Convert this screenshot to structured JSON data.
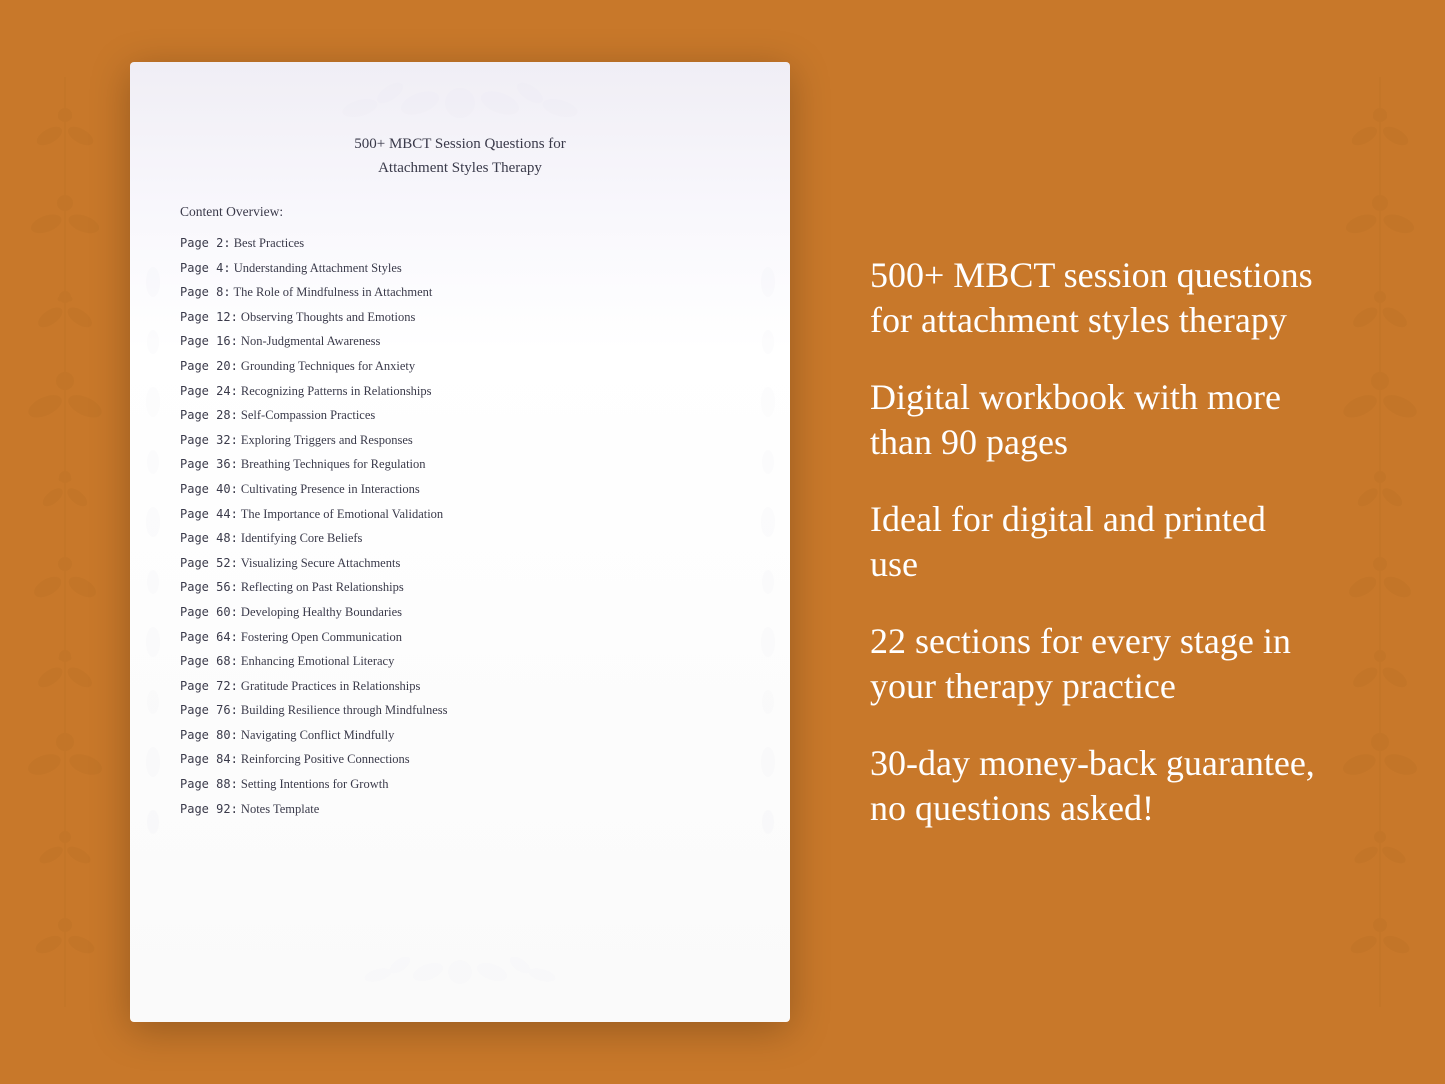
{
  "background_color": "#C8782A",
  "document": {
    "title_line1": "500+ MBCT Session Questions for",
    "title_line2": "Attachment Styles Therapy",
    "content_overview_label": "Content Overview:",
    "toc_items": [
      {
        "page": "Page  2:",
        "title": "Best Practices"
      },
      {
        "page": "Page  4:",
        "title": "Understanding Attachment Styles"
      },
      {
        "page": "Page  8:",
        "title": "The Role of Mindfulness in Attachment"
      },
      {
        "page": "Page 12:",
        "title": "Observing Thoughts and Emotions"
      },
      {
        "page": "Page 16:",
        "title": "Non-Judgmental Awareness"
      },
      {
        "page": "Page 20:",
        "title": "Grounding Techniques for Anxiety"
      },
      {
        "page": "Page 24:",
        "title": "Recognizing Patterns in Relationships"
      },
      {
        "page": "Page 28:",
        "title": "Self-Compassion Practices"
      },
      {
        "page": "Page 32:",
        "title": "Exploring Triggers and Responses"
      },
      {
        "page": "Page 36:",
        "title": "Breathing Techniques for Regulation"
      },
      {
        "page": "Page 40:",
        "title": "Cultivating Presence in Interactions"
      },
      {
        "page": "Page 44:",
        "title": "The Importance of Emotional Validation"
      },
      {
        "page": "Page 48:",
        "title": "Identifying Core Beliefs"
      },
      {
        "page": "Page 52:",
        "title": "Visualizing Secure Attachments"
      },
      {
        "page": "Page 56:",
        "title": "Reflecting on Past Relationships"
      },
      {
        "page": "Page 60:",
        "title": "Developing Healthy Boundaries"
      },
      {
        "page": "Page 64:",
        "title": "Fostering Open Communication"
      },
      {
        "page": "Page 68:",
        "title": "Enhancing Emotional Literacy"
      },
      {
        "page": "Page 72:",
        "title": "Gratitude Practices in Relationships"
      },
      {
        "page": "Page 76:",
        "title": "Building Resilience through Mindfulness"
      },
      {
        "page": "Page 80:",
        "title": "Navigating Conflict Mindfully"
      },
      {
        "page": "Page 84:",
        "title": "Reinforcing Positive Connections"
      },
      {
        "page": "Page 88:",
        "title": "Setting Intentions for Growth"
      },
      {
        "page": "Page 92:",
        "title": "Notes Template"
      }
    ]
  },
  "features": [
    "500+ MBCT session questions for attachment styles therapy",
    "Digital workbook with more than 90 pages",
    "Ideal for digital and printed use",
    "22 sections for every stage in your therapy practice",
    "30-day money-back guarantee, no questions asked!"
  ]
}
